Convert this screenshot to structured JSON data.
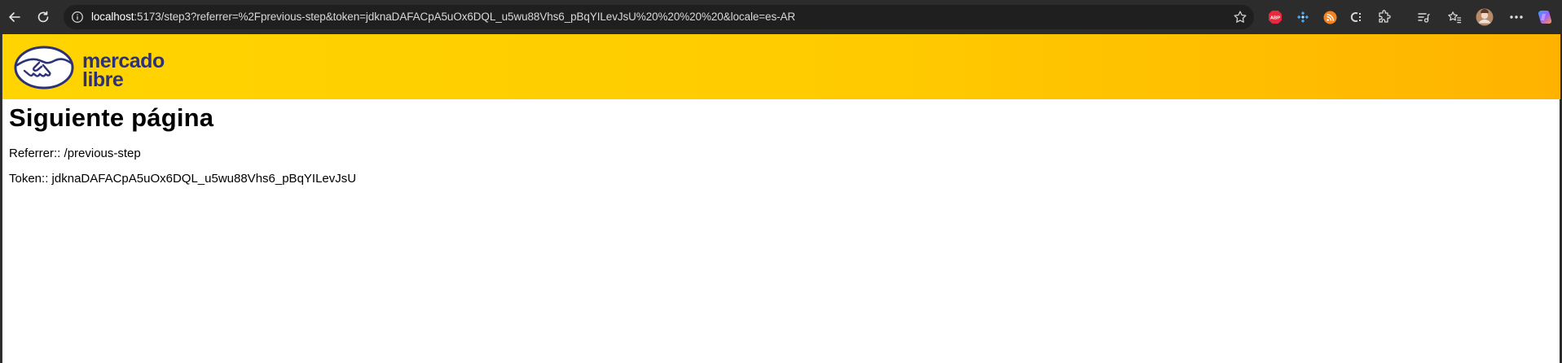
{
  "browser": {
    "url_host": "localhost",
    "url_rest": ":5173/step3?referrer=%2Fprevious-step&token=jdknaDAFACpA5uOx6DQL_u5wu88Vhs6_pBqYILevJsU%20%20%20%20&locale=es-AR",
    "extensions": [
      "adblock-plus-icon",
      "puzzle-blue-icon",
      "rss-orange-icon",
      "c-extension-icon",
      "extensions-puzzle-icon",
      "media-icon",
      "favorites-icon",
      "profile-avatar",
      "settings-menu-icon",
      "copilot-icon"
    ],
    "abp_label": "ABP"
  },
  "header": {
    "logo_line1": "mercado",
    "logo_line2": "libre"
  },
  "main": {
    "title": "Siguiente página",
    "referrer_label": "Referrer::",
    "referrer_value": "/previous-step",
    "token_label": "Token::",
    "token_value": "jdknaDAFACpA5uOx6DQL_u5wu88Vhs6_pBqYILevJsU"
  },
  "colors": {
    "header_yellow": "#ffd400",
    "brand_navy": "#2d3277",
    "chrome_bg": "#2c2c2c"
  }
}
